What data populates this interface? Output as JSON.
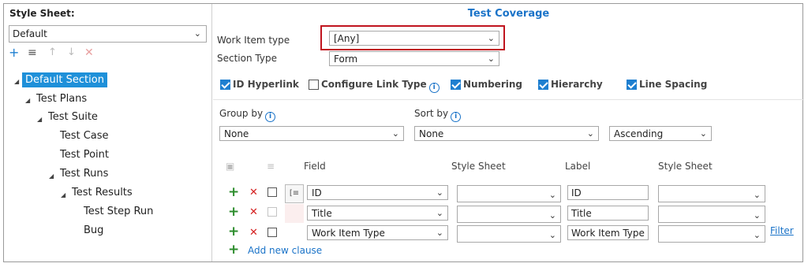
{
  "left": {
    "stylesheet_label": "Style Sheet:",
    "stylesheet_value": "Default",
    "tree": [
      {
        "label": "Default Section",
        "level": 0,
        "selected": true
      },
      {
        "label": "Test Plans",
        "level": 1
      },
      {
        "label": "Test Suite",
        "level": 2
      },
      {
        "label": "Test Case",
        "level": 3
      },
      {
        "label": "Test Point",
        "level": 3
      },
      {
        "label": "Test Runs",
        "level": 3
      },
      {
        "label": "Test Results",
        "level": 4
      },
      {
        "label": "Test Step Run",
        "level": 5
      },
      {
        "label": "Bug",
        "level": 5
      }
    ]
  },
  "right": {
    "title": "Test Coverage",
    "work_item_type_label": "Work Item type",
    "work_item_type_value": "[Any]",
    "section_type_label": "Section Type",
    "section_type_value": "Form",
    "options": {
      "id_hyperlink": "ID Hyperlink",
      "configure_link_type": "Configure Link Type",
      "numbering": "Numbering",
      "hierarchy": "Hierarchy",
      "line_spacing": "Line Spacing"
    },
    "group_by_label": "Group by",
    "group_by_value": "None",
    "sort_by_label": "Sort by",
    "sort_by_value": "None",
    "sort_order_value": "Ascending",
    "columns": {
      "field": "Field",
      "style_sheet": "Style Sheet",
      "label": "Label",
      "style_sheet_2": "Style Sheet"
    },
    "rows": [
      {
        "field": "ID",
        "label": "ID"
      },
      {
        "field": "Title",
        "label": "Title"
      },
      {
        "field": "Work Item Type",
        "label": "Work Item Type"
      }
    ],
    "filter_link": "Filter",
    "add_clause": "Add new clause"
  },
  "colors": {
    "accent": "#1a73c8",
    "selection": "#1e90d9",
    "highlight": "#c0141e",
    "add": "#2c8c2c",
    "delete": "#d42020"
  }
}
